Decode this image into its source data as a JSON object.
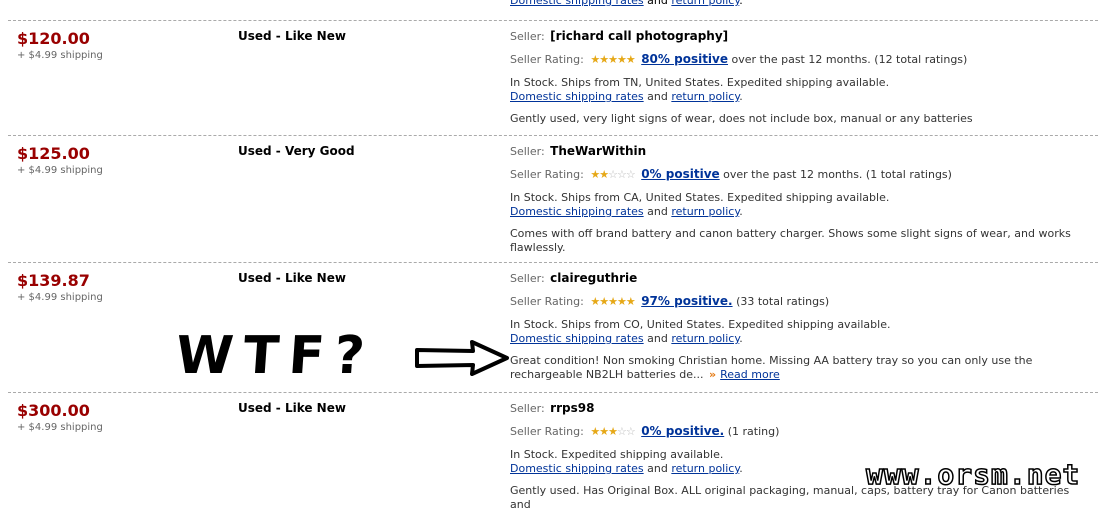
{
  "top_links": {
    "shipping": "Domestic shipping rates",
    "and": "and",
    "return": "return policy",
    "dot": "."
  },
  "labels": {
    "seller": "Seller:",
    "seller_rating": "Seller Rating:",
    "read_more": "Read more"
  },
  "listings": [
    {
      "price": "$120.00",
      "shipping": "+ $4.99 shipping",
      "condition": "Used - Like New",
      "seller": "[richard call photography]",
      "stars": 4.5,
      "positive": "80% positive",
      "rating_suffix": "over the past 12 months. (12 total ratings)",
      "stock": "In Stock. Ships from TN, United States. Expedited shipping available.",
      "comment": "Gently used, very light signs of wear, does not include box, manual or any batteries"
    },
    {
      "price": "$125.00",
      "shipping": "+ $4.99 shipping",
      "condition": "Used - Very Good",
      "seller": "TheWarWithin",
      "stars": 2,
      "positive": "0% positive",
      "rating_suffix": "over the past 12 months. (1 total ratings)",
      "stock": "In Stock. Ships from CA, United States. Expedited shipping available.",
      "comment": "Comes with off brand battery and canon battery charger. Shows some slight signs of wear, and works flawlessly."
    },
    {
      "price": "$139.87",
      "shipping": "+ $4.99 shipping",
      "condition": "Used - Like New",
      "seller": "claireguthrie",
      "stars": 5,
      "positive": "97% positive.",
      "rating_suffix": "(33 total ratings)",
      "stock": "In Stock. Ships from CO, United States. Expedited shipping available.",
      "comment": "Great condition! Non smoking Christian home. Missing AA battery tray so you can only use the rechargeable NB2LH batteries de..."
    },
    {
      "price": "$300.00",
      "shipping": "+ $4.99 shipping",
      "condition": "Used - Like New",
      "seller": "rrps98",
      "stars": 3,
      "positive": "0% positive.",
      "rating_suffix": "(1 rating)",
      "stock": "In Stock. Expedited shipping available.",
      "comment": "Gently used. Has Original Box. ALL original packaging, manual, caps, battery tray for Canon batteries and"
    }
  ],
  "annotation": {
    "text": "WTF?"
  },
  "watermark": "www.orsm.net",
  "colors": {
    "price": "#990000",
    "link": "#003399",
    "star": "#e6a817"
  }
}
